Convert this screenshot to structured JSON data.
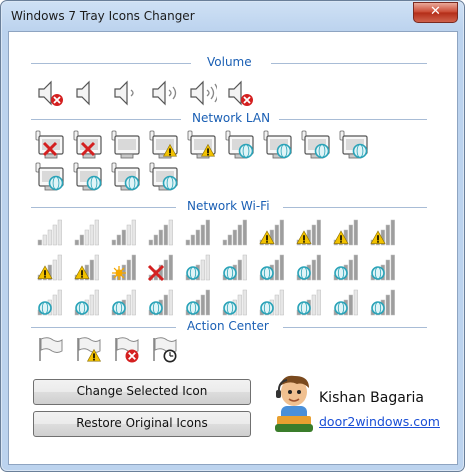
{
  "window": {
    "title": "Windows 7 Tray Icons Changer",
    "close_glyph": "✕"
  },
  "sections": {
    "volume": "Volume",
    "network_lan": "Network LAN",
    "network_wifi": "Network Wi-Fi",
    "action_center": "Action Center"
  },
  "icons": {
    "volume": [
      "speaker-muted-icon",
      "speaker-0-icon",
      "speaker-1-icon",
      "speaker-2-icon",
      "speaker-3-icon",
      "speaker-error-icon"
    ],
    "lan": [
      "lan-disconnected-icon",
      "lan-error-icon",
      "lan-connected-icon",
      "lan-warning-icon",
      "lan-warning-large-icon",
      "lan-globe-icon",
      "lan-globe-icon",
      "lan-globe-icon",
      "lan-globe-icon",
      "lan-globe-icon",
      "lan-globe-icon",
      "lan-globe-icon",
      "lan-globe-icon"
    ],
    "wifi": [
      "wifi-1-bar-icon",
      "wifi-2-bars-icon",
      "wifi-3-bars-icon",
      "wifi-4-bars-icon",
      "wifi-5-bars-icon",
      "wifi-full-icon",
      "wifi-warning-icon",
      "wifi-warning-icon",
      "wifi-warning-icon",
      "wifi-warning-icon",
      "wifi-warning-icon",
      "wifi-warning-icon",
      "wifi-searching-icon",
      "wifi-error-icon",
      "wifi-globe-icon",
      "wifi-globe-icon",
      "wifi-globe-icon",
      "wifi-globe-icon",
      "wifi-globe-icon",
      "wifi-globe-icon",
      "wifi-globe-icon",
      "wifi-globe-icon",
      "wifi-globe-icon",
      "wifi-globe-icon",
      "wifi-globe-icon",
      "wifi-globe-icon",
      "wifi-globe-icon",
      "wifi-globe-icon",
      "wifi-globe-icon",
      "wifi-globe-icon"
    ],
    "action_center": [
      "flag-icon",
      "flag-warning-icon",
      "flag-error-icon",
      "flag-clock-icon"
    ]
  },
  "buttons": {
    "change": "Change Selected Icon",
    "restore": "Restore Original Icons"
  },
  "author": {
    "name": "Kishan Bagaria",
    "website": "door2windows.com"
  },
  "colors": {
    "section_label": "#1a5fb4",
    "link": "#1a4fd6",
    "error_red": "#d42020",
    "warning_yellow": "#f2c200",
    "globe_teal": "#2aa3b8"
  }
}
